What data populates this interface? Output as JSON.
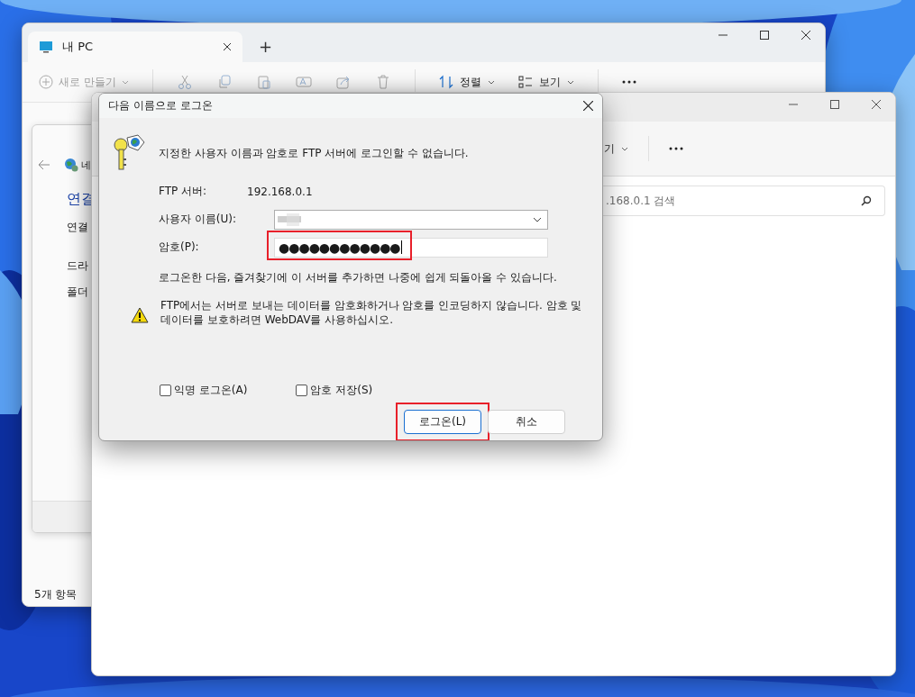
{
  "back_window": {
    "tab": {
      "title": "내 PC",
      "selected": true
    },
    "new_tab": "+",
    "toolbar": {
      "new": "새로 만들기",
      "sort": "정렬",
      "view": "보기"
    },
    "side_panel": {
      "location": "네",
      "heading": "연결",
      "items": [
        "연결",
        "드라",
        "폴더"
      ]
    },
    "status_bar": "5개 항목"
  },
  "front_window": {
    "toolbar": {
      "view": "기"
    },
    "search": {
      "placeholder": ".168.0.1 검색"
    }
  },
  "dialog": {
    "title": "다음 이름으로 로그온",
    "message": "지정한 사용자 이름과 암호로 FTP 서버에 로그인할 수 없습니다.",
    "fields": [
      {
        "label": "FTP 서버:",
        "value": "192.168.0.1",
        "kind": "static",
        "highlighted": false
      },
      {
        "label": "사용자 이름(U):",
        "kind": "combo",
        "highlighted": false
      },
      {
        "label": "암호(P):",
        "value": "●●●●●●●●●●●●",
        "kind": "password",
        "highlighted": true
      }
    ],
    "hint": "로그온한 다음, 즐겨찾기에 이 서버를 추가하면 나중에 쉽게 되돌아올 수 있습니다.",
    "warning": "FTP에서는 서버로 보내는 데이터를 암호화하거나 암호를 인코딩하지 않습니다. 암호 및 데이터를 보호하려면 WebDAV를 사용하십시오.",
    "checkboxes": [
      {
        "label": "익명 로그온(A)",
        "checked": false
      },
      {
        "label": "암호 저장(S)",
        "checked": false
      }
    ],
    "buttons": [
      {
        "label": "로그온(L)",
        "default": true,
        "highlighted": true
      },
      {
        "label": "취소",
        "default": false,
        "highlighted": false
      }
    ]
  }
}
